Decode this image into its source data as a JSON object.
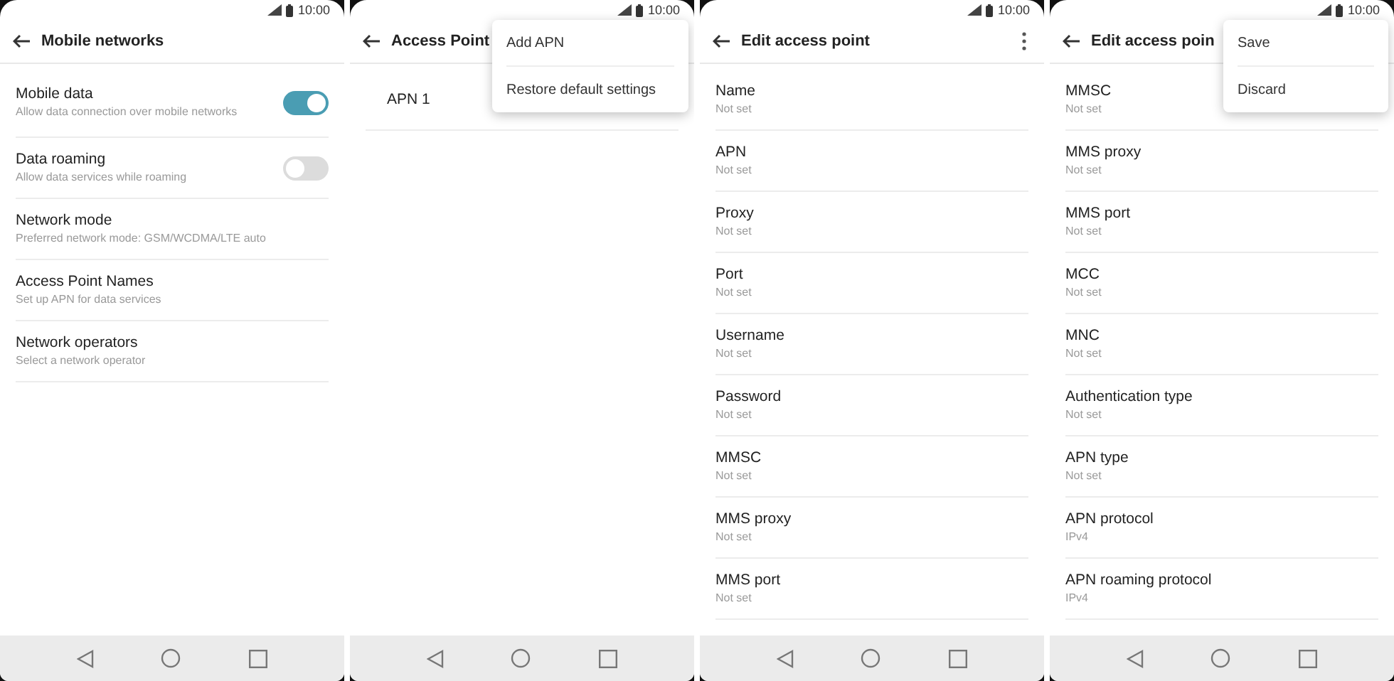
{
  "screens": [
    {
      "status_time": "10:00",
      "title": "Mobile networks",
      "items": [
        {
          "kind": "toggle",
          "title": "Mobile data",
          "subtitle": "Allow data connection over mobile networks",
          "on": true
        },
        {
          "kind": "toggle",
          "title": "Data roaming",
          "subtitle": "Allow data services while roaming",
          "on": false
        },
        {
          "kind": "plain",
          "title": "Network mode",
          "subtitle": "Preferred network mode: GSM/WCDMA/LTE auto"
        },
        {
          "kind": "plain",
          "title": "Access Point Names",
          "subtitle": "Set up APN for data services"
        },
        {
          "kind": "plain",
          "title": "Network operators",
          "subtitle": "Select a network operator"
        }
      ]
    },
    {
      "status_time": "10:00",
      "title": "Access Point",
      "items": [
        {
          "kind": "indented",
          "title": "APN 1"
        }
      ],
      "menu": [
        {
          "label": "Add APN"
        },
        {
          "label": "Restore default settings"
        }
      ]
    },
    {
      "status_time": "10:00",
      "title": "Edit access point",
      "more_button": true,
      "items": [
        {
          "kind": "plain",
          "title": "Name",
          "subtitle": "Not set"
        },
        {
          "kind": "plain",
          "title": "APN",
          "subtitle": "Not set"
        },
        {
          "kind": "plain",
          "title": "Proxy",
          "subtitle": "Not set"
        },
        {
          "kind": "plain",
          "title": "Port",
          "subtitle": "Not set"
        },
        {
          "kind": "plain",
          "title": "Username",
          "subtitle": "Not set"
        },
        {
          "kind": "plain",
          "title": "Password",
          "subtitle": "Not set"
        },
        {
          "kind": "plain",
          "title": "MMSC",
          "subtitle": "Not set"
        },
        {
          "kind": "plain",
          "title": "MMS proxy",
          "subtitle": "Not set"
        },
        {
          "kind": "plain",
          "title": "MMS port",
          "subtitle": "Not set"
        }
      ]
    },
    {
      "status_time": "10:00",
      "title": "Edit access poin",
      "items": [
        {
          "kind": "plain",
          "title": "MMSC",
          "subtitle": "Not set"
        },
        {
          "kind": "plain",
          "title": "MMS proxy",
          "subtitle": "Not set"
        },
        {
          "kind": "plain",
          "title": "MMS port",
          "subtitle": "Not set"
        },
        {
          "kind": "plain",
          "title": "MCC",
          "subtitle": "Not set"
        },
        {
          "kind": "plain",
          "title": "MNC",
          "subtitle": "Not set"
        },
        {
          "kind": "plain",
          "title": "Authentication type",
          "subtitle": "Not set"
        },
        {
          "kind": "plain",
          "title": "APN type",
          "subtitle": "Not set"
        },
        {
          "kind": "plain",
          "title": "APN protocol",
          "subtitle": "IPv4"
        },
        {
          "kind": "plain",
          "title": "APN roaming protocol",
          "subtitle": "IPv4"
        }
      ],
      "menu": [
        {
          "label": "Save"
        },
        {
          "label": "Discard"
        }
      ]
    }
  ]
}
